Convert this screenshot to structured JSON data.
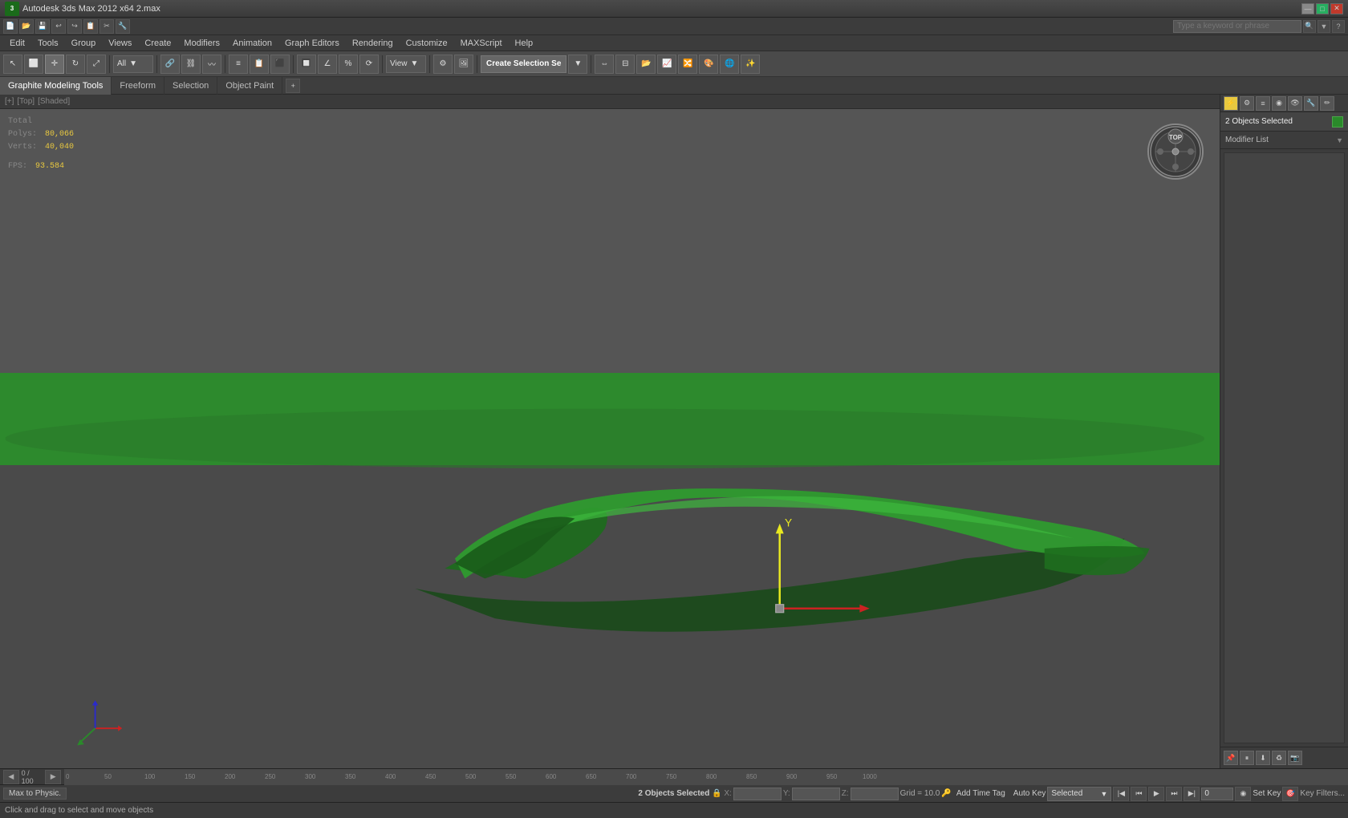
{
  "titlebar": {
    "title": "Autodesk 3ds Max 2012 x64   2.max",
    "logo": "3ds",
    "controls": {
      "minimize": "—",
      "maximize": "□",
      "close": "✕"
    }
  },
  "quickaccess": {
    "search_placeholder": "Type a keyword or phrase",
    "buttons": [
      "📁",
      "💾",
      "↩",
      "↪",
      "📋",
      "✂",
      "📐",
      "🔧"
    ]
  },
  "menubar": {
    "items": [
      "Edit",
      "Tools",
      "Group",
      "Views",
      "Create",
      "Modifiers",
      "Animation",
      "Graph Editors",
      "Rendering",
      "Customize",
      "MAXScript",
      "Help"
    ]
  },
  "toolbar": {
    "create_selection_label": "Create Selection Se",
    "view_dropdown": "View",
    "select_all_dropdown": "All"
  },
  "subtoolbar": {
    "tabs": [
      "Graphite Modeling Tools",
      "Freeform",
      "Selection",
      "Object Paint"
    ]
  },
  "viewport": {
    "header": [
      "[+]",
      "[Top]",
      "[Shaded]"
    ],
    "stats": {
      "total_label": "Total",
      "polys_label": "Polys:",
      "polys_value": "80,066",
      "verts_label": "Verts:",
      "verts_value": "40,040",
      "fps_label": "FPS:",
      "fps_value": "93.584"
    },
    "gizmo_label": "Top"
  },
  "rightpanel": {
    "objects_selected": "2 Objects Selected",
    "modifier_list": "Modifier List",
    "panel_icons": [
      "⚡",
      "⚙",
      "≡",
      "◉",
      "✏"
    ]
  },
  "statusbar": {
    "objects": "2 Objects Selected",
    "x_label": "X:",
    "y_label": "Y:",
    "z_label": "Z:",
    "grid": "Grid = 10.0",
    "autokey_label": "Auto Key",
    "autokey_selected": "Selected",
    "set_key_label": "Set Key"
  },
  "bottombar": {
    "click_msg": "Click and drag to select and move objects",
    "maxphysc": "Max to Physic."
  },
  "timeline": {
    "current_frame": "0",
    "total_frames": "100",
    "frame_display": "0 / 100",
    "markers": [
      "0",
      "50",
      "100",
      "150",
      "200",
      "250",
      "300",
      "350",
      "400",
      "450",
      "500",
      "550",
      "600",
      "650",
      "700",
      "750",
      "800",
      "850",
      "900",
      "950",
      "1000"
    ]
  },
  "colors": {
    "green_object": "#2d8a2d",
    "bright_green": "#4aaa4a",
    "yellow_text": "#e8c840",
    "dark_bg": "#3c3c3c",
    "viewport_bg": "#555555"
  }
}
